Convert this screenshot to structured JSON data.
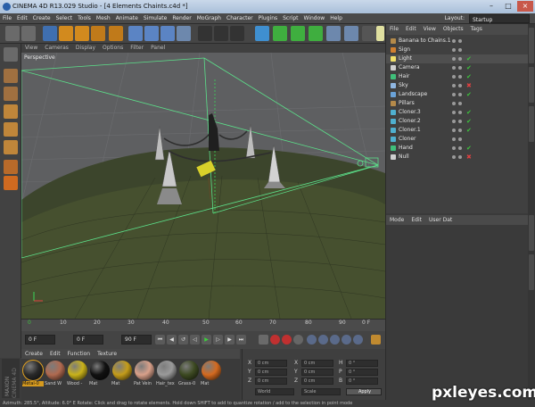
{
  "window": {
    "title": "CINEMA 4D R13.029 Studio - [4 Elements Chaints.c4d *]"
  },
  "menubar": {
    "items": [
      "File",
      "Edit",
      "Create",
      "Select",
      "Tools",
      "Mesh",
      "Animate",
      "Simulate",
      "Render",
      "MoGraph",
      "Character",
      "Plugins",
      "Script",
      "Window",
      "Help"
    ],
    "layout_label": "Layout:",
    "layout_value": "Startup"
  },
  "viewport": {
    "menu": [
      "View",
      "Cameras",
      "Display",
      "Options",
      "Filter",
      "Panel"
    ],
    "label": "Perspective"
  },
  "object_manager": {
    "menu": [
      "File",
      "Edit",
      "View",
      "Objects",
      "Tags"
    ],
    "objects": [
      {
        "name": "Banana to Chains.1",
        "color": "#b48a4a",
        "status": "none"
      },
      {
        "name": "Sign",
        "color": "#d07f30",
        "status": "none"
      },
      {
        "name": "Light",
        "color": "#f2e06a",
        "status": "check"
      },
      {
        "name": "Camera",
        "color": "#cfcfcf",
        "status": "check"
      },
      {
        "name": "Hair",
        "color": "#3fbf7a",
        "status": "check"
      },
      {
        "name": "Sky",
        "color": "#8fb7e2",
        "status": "x"
      },
      {
        "name": "Landscape",
        "color": "#6aa2d8",
        "status": "check"
      },
      {
        "name": "Pillars",
        "color": "#b48a4a",
        "status": "none"
      },
      {
        "name": "Cloner.3",
        "color": "#4fb0d0",
        "status": "check"
      },
      {
        "name": "Cloner.2",
        "color": "#4fb0d0",
        "status": "check"
      },
      {
        "name": "Cloner.1",
        "color": "#4fb0d0",
        "status": "check"
      },
      {
        "name": "Cloner",
        "color": "#4fb0d0",
        "status": "none"
      },
      {
        "name": "Hand",
        "color": "#3fbf7a",
        "status": "check"
      },
      {
        "name": "Null",
        "color": "#cfcfcf",
        "status": "x"
      }
    ]
  },
  "attribute_manager": {
    "menu": [
      "Mode",
      "Edit",
      "User Dat"
    ]
  },
  "timeline": {
    "ticks": [
      "0",
      "10",
      "20",
      "30",
      "40",
      "50",
      "60",
      "70",
      "80",
      "90"
    ],
    "end_label": "0 F"
  },
  "playback": {
    "current": "0 F",
    "start": "0 F",
    "end": "90 F"
  },
  "material_manager": {
    "menu": [
      "Create",
      "Edit",
      "Function",
      "Texture"
    ],
    "materials": [
      {
        "label": "Metal-0",
        "color": "#2a2a2a"
      },
      {
        "label": "Sand W",
        "color": "#b06a50"
      },
      {
        "label": "Wood -",
        "color": "#c9b21a"
      },
      {
        "label": "Mat",
        "color": "#111111"
      },
      {
        "label": "Mat",
        "color": "#c49c1a"
      },
      {
        "label": "Pat Vein",
        "color": "#d8a08a"
      },
      {
        "label": "Hair_tex",
        "color": "#9a9a9a"
      },
      {
        "label": "Grass-0",
        "color": "#3d4a22"
      },
      {
        "label": "Mat",
        "color": "#d46a20"
      }
    ]
  },
  "coordinates": {
    "rows": [
      {
        "axis": "X",
        "pos": "0 cm",
        "sax": "X",
        "size": "0 cm",
        "rax": "H",
        "rot": "0 °"
      },
      {
        "axis": "Y",
        "pos": "0 cm",
        "sax": "Y",
        "size": "0 cm",
        "rax": "P",
        "rot": "0 °"
      },
      {
        "axis": "Z",
        "pos": "0 cm",
        "sax": "Z",
        "size": "0 cm",
        "rax": "B",
        "rot": "0 °"
      }
    ],
    "mode_world": "World",
    "mode_scale": "Scale",
    "apply": "Apply"
  },
  "brand": {
    "maxon": "MAXON",
    "c4d": "CINEMA 4D"
  },
  "status": {
    "text": "Azimuth: 285.5°, Altitude: 6.0°  E    Rotate: Click and drag to rotate elements. Hold down SHIFT to add to quantize rotation / add to the selection in point mode"
  },
  "watermark": "pxleyes.com"
}
